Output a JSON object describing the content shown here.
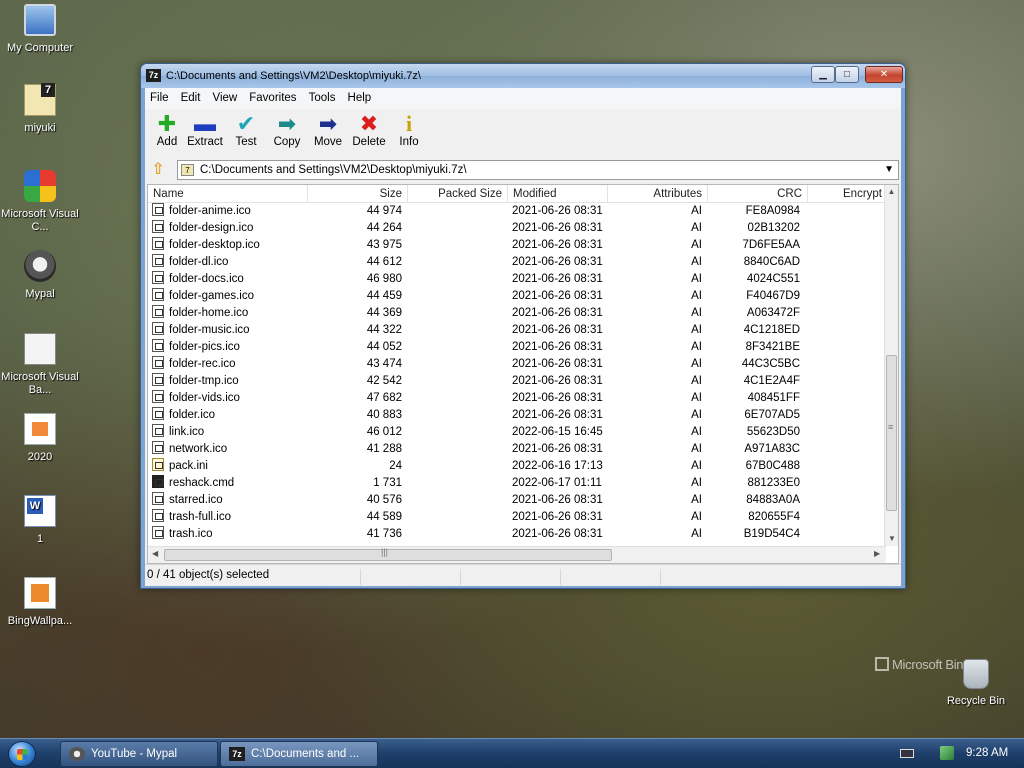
{
  "desktop": {
    "icons": [
      {
        "label": "My Computer",
        "icon": "computer-icon"
      },
      {
        "label": "miyuki",
        "icon": "7z-archive-icon"
      },
      {
        "label": "Microsoft Visual C...",
        "icon": "visual-c-icon"
      },
      {
        "label": "Mypal",
        "icon": "mypal-icon"
      },
      {
        "label": "Microsoft Visual Ba...",
        "icon": "visual-basic-icon"
      },
      {
        "label": "2020",
        "icon": "document-icon"
      },
      {
        "label": "1",
        "icon": "word-document-icon"
      },
      {
        "label": "BingWallpa...",
        "icon": "bing-wallpaper-icon"
      },
      {
        "label": "Recycle Bin",
        "icon": "recycle-bin-icon"
      }
    ],
    "watermark": "Microsoft Bin"
  },
  "window": {
    "title": "C:\\Documents and Settings\\VM2\\Desktop\\miyuki.7z\\",
    "app_icon": "7z",
    "menu": [
      "File",
      "Edit",
      "View",
      "Favorites",
      "Tools",
      "Help"
    ],
    "toolbar": [
      {
        "label": "Add",
        "icon": "add-icon",
        "glyph": "✚",
        "color": "#22aa22"
      },
      {
        "label": "Extract",
        "icon": "extract-icon",
        "glyph": "▬",
        "color": "#1d3fbf"
      },
      {
        "label": "Test",
        "icon": "test-icon",
        "glyph": "✔",
        "color": "#1fa7b8"
      },
      {
        "label": "Copy",
        "icon": "copy-icon",
        "glyph": "➡",
        "color": "#1d8a8a"
      },
      {
        "label": "Move",
        "icon": "move-icon",
        "glyph": "➡",
        "color": "#1d2f8f"
      },
      {
        "label": "Delete",
        "icon": "delete-icon",
        "glyph": "✖",
        "color": "#dd1c1c"
      },
      {
        "label": "Info",
        "icon": "info-icon",
        "glyph": "i",
        "color": "#c8a400"
      }
    ],
    "address": "C:\\Documents and Settings\\VM2\\Desktop\\miyuki.7z\\",
    "columns": {
      "name": "Name",
      "size": "Size",
      "packed": "Packed Size",
      "modified": "Modified",
      "attributes": "Attributes",
      "crc": "CRC",
      "encrypted": "Encrypt"
    },
    "files": [
      {
        "name": "folder-anime.ico",
        "size": "44 974",
        "modified": "2021-06-26 08:31",
        "attr": "AI",
        "crc": "FE8A0984",
        "type": "ico"
      },
      {
        "name": "folder-design.ico",
        "size": "44 264",
        "modified": "2021-06-26 08:31",
        "attr": "AI",
        "crc": "02B13202",
        "type": "ico"
      },
      {
        "name": "folder-desktop.ico",
        "size": "43 975",
        "modified": "2021-06-26 08:31",
        "attr": "AI",
        "crc": "7D6FE5AA",
        "type": "ico"
      },
      {
        "name": "folder-dl.ico",
        "size": "44 612",
        "modified": "2021-06-26 08:31",
        "attr": "AI",
        "crc": "8840C6AD",
        "type": "ico"
      },
      {
        "name": "folder-docs.ico",
        "size": "46 980",
        "modified": "2021-06-26 08:31",
        "attr": "AI",
        "crc": "4024C551",
        "type": "ico"
      },
      {
        "name": "folder-games.ico",
        "size": "44 459",
        "modified": "2021-06-26 08:31",
        "attr": "AI",
        "crc": "F40467D9",
        "type": "ico"
      },
      {
        "name": "folder-home.ico",
        "size": "44 369",
        "modified": "2021-06-26 08:31",
        "attr": "AI",
        "crc": "A063472F",
        "type": "ico"
      },
      {
        "name": "folder-music.ico",
        "size": "44 322",
        "modified": "2021-06-26 08:31",
        "attr": "AI",
        "crc": "4C1218ED",
        "type": "ico"
      },
      {
        "name": "folder-pics.ico",
        "size": "44 052",
        "modified": "2021-06-26 08:31",
        "attr": "AI",
        "crc": "8F3421BE",
        "type": "ico"
      },
      {
        "name": "folder-rec.ico",
        "size": "43 474",
        "modified": "2021-06-26 08:31",
        "attr": "AI",
        "crc": "44C3C5BC",
        "type": "ico"
      },
      {
        "name": "folder-tmp.ico",
        "size": "42 542",
        "modified": "2021-06-26 08:31",
        "attr": "AI",
        "crc": "4C1E2A4F",
        "type": "ico"
      },
      {
        "name": "folder-vids.ico",
        "size": "47 682",
        "modified": "2021-06-26 08:31",
        "attr": "AI",
        "crc": "408451FF",
        "type": "ico"
      },
      {
        "name": "folder.ico",
        "size": "40 883",
        "modified": "2021-06-26 08:31",
        "attr": "AI",
        "crc": "6E707AD5",
        "type": "ico"
      },
      {
        "name": "link.ico",
        "size": "46 012",
        "modified": "2022-06-15 16:45",
        "attr": "AI",
        "crc": "55623D50",
        "type": "ico"
      },
      {
        "name": "network.ico",
        "size": "41 288",
        "modified": "2021-06-26 08:31",
        "attr": "AI",
        "crc": "A971A83C",
        "type": "ico"
      },
      {
        "name": "pack.ini",
        "size": "24",
        "modified": "2022-06-16 17:13",
        "attr": "AI",
        "crc": "67B0C488",
        "type": "ini"
      },
      {
        "name": "reshack.cmd",
        "size": "1 731",
        "modified": "2022-06-17 01:11",
        "attr": "AI",
        "crc": "881233E0",
        "type": "cmd"
      },
      {
        "name": "starred.ico",
        "size": "40 576",
        "modified": "2021-06-26 08:31",
        "attr": "AI",
        "crc": "84883A0A",
        "type": "ico"
      },
      {
        "name": "trash-full.ico",
        "size": "44 589",
        "modified": "2021-06-26 08:31",
        "attr": "AI",
        "crc": "820655F4",
        "type": "ico"
      },
      {
        "name": "trash.ico",
        "size": "41 736",
        "modified": "2021-06-26 08:31",
        "attr": "AI",
        "crc": "B19D54C4",
        "type": "ico"
      }
    ],
    "status": "0 / 41 object(s) selected"
  },
  "taskbar": {
    "buttons": [
      {
        "label": "YouTube - Mypal",
        "icon": "mypal-icon",
        "active": false
      },
      {
        "label": "C:\\Documents and ...",
        "icon": "7z-icon",
        "active": true
      }
    ],
    "clock": "9:28 AM"
  }
}
